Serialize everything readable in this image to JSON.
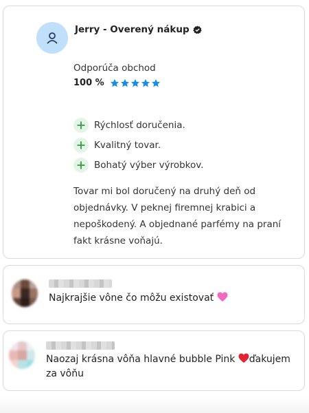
{
  "review": {
    "reviewer": "Jerry - Overený nákup",
    "recommend_label": "Odporúča obchod",
    "recommend_percent": "100 %",
    "rating": 5,
    "rating_max": 5,
    "star_color": "#1a8ee6",
    "pros": [
      "Rýchlosť doručenia.",
      "Kvalitný tovar.",
      "Bohatý výber výrobkov."
    ],
    "body": "Tovar mi bol doručený na druhý deň od objednávky. V peknej firemnej krabici a nepoškodený. A objednané parfémy na praní fakt krásne voňajú."
  },
  "comments": [
    {
      "text": "Najkrajšie vône čo môžu existovať",
      "emoji": "pink-heart"
    },
    {
      "text_before": "Naozaj krásna vôňa hlavné bubble Pink ",
      "emoji": "red-heart",
      "text_after": "ďakujem za vôňu"
    }
  ],
  "colors": {
    "accent_blue": "#1a8ee6",
    "plus_green": "#2e9e47",
    "avatar_bg": "#bfdffb"
  }
}
